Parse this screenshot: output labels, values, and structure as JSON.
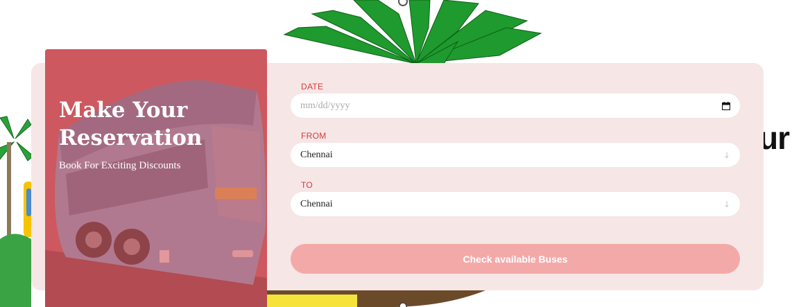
{
  "hero": {
    "title": "Make Your Reservation",
    "subtitle": "Book For Exciting Discounts"
  },
  "form": {
    "date": {
      "label": "DATE",
      "placeholder": "mm/dd/yyyy",
      "icon": "calendar-icon"
    },
    "from": {
      "label": "FROM",
      "value": "Chennai",
      "icon": "arrow-down-icon"
    },
    "to": {
      "label": "TO",
      "value": "Chennai",
      "icon": "arrow-down-icon"
    },
    "submit_label": "Check available Buses"
  },
  "background": {
    "heading_fragment": "ur"
  },
  "colors": {
    "accent": "#d63a3a",
    "card_bg": "#f6e6e6",
    "button_bg": "#f4a9a9",
    "hero_overlay": "#de5860"
  }
}
